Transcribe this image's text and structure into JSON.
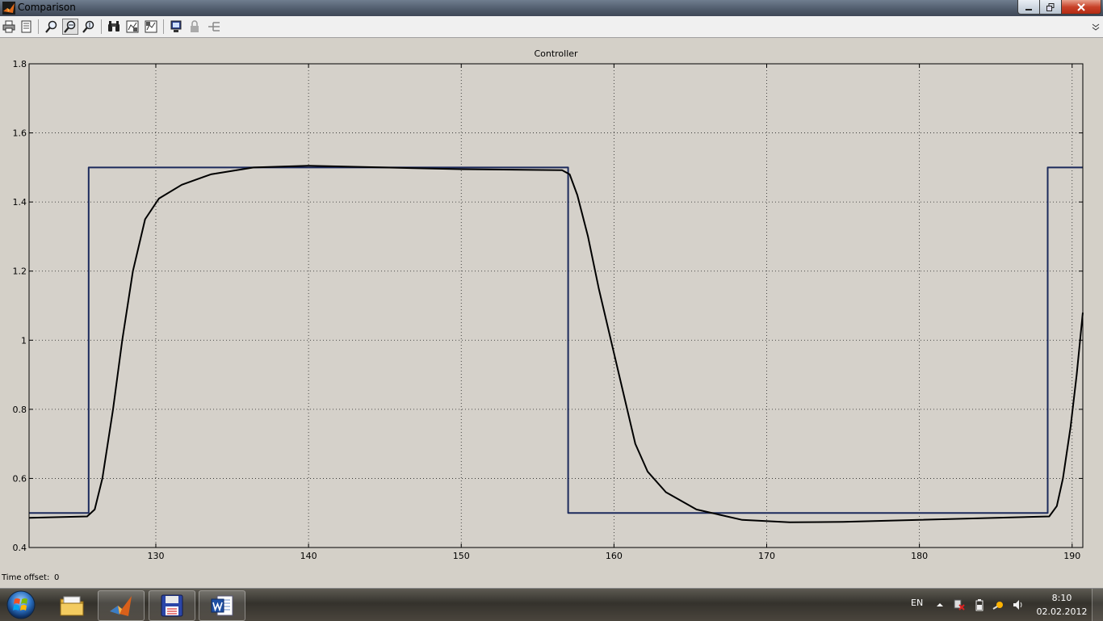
{
  "window": {
    "title": "Comparison"
  },
  "toolbar": {
    "buttons": [
      {
        "name": "print-icon"
      },
      {
        "name": "print-preview-icon"
      },
      {
        "name": "zoom-in-icon"
      },
      {
        "name": "zoom-x-icon",
        "active": true
      },
      {
        "name": "zoom-y-icon"
      },
      {
        "name": "binoculars-icon"
      },
      {
        "name": "save-axes-icon"
      },
      {
        "name": "restore-axes-icon"
      },
      {
        "name": "floating-scope-icon"
      },
      {
        "name": "lock-icon"
      },
      {
        "name": "signal-selector-icon"
      }
    ]
  },
  "chart_data": {
    "type": "line",
    "title": "Controller",
    "xlabel": "",
    "ylabel": "",
    "xlim": [
      121.7,
      190.7
    ],
    "ylim": [
      0.4,
      1.8
    ],
    "xticks": [
      130,
      140,
      150,
      160,
      170,
      180,
      190
    ],
    "yticks": [
      0.4,
      0.6,
      0.8,
      1,
      1.2,
      1.4,
      1.6,
      1.8
    ],
    "grid": true,
    "colors": {
      "reference": "#1c2a5c",
      "output": "#000000",
      "background": "#d4d0c8",
      "axes_bg": "#d5d1ca"
    },
    "series": [
      {
        "key": "reference",
        "points": [
          [
            121.7,
            0.5
          ],
          [
            125.6,
            0.5
          ],
          [
            125.6,
            1.5
          ],
          [
            157.0,
            1.5
          ],
          [
            157.0,
            0.5
          ],
          [
            188.4,
            0.5
          ],
          [
            188.4,
            1.5
          ],
          [
            190.7,
            1.5
          ]
        ]
      },
      {
        "key": "output",
        "points": [
          [
            121.7,
            0.486
          ],
          [
            125.5,
            0.49
          ],
          [
            126.0,
            0.51
          ],
          [
            126.5,
            0.6
          ],
          [
            127.2,
            0.8
          ],
          [
            127.8,
            1.0
          ],
          [
            128.5,
            1.2
          ],
          [
            129.3,
            1.35
          ],
          [
            130.2,
            1.41
          ],
          [
            131.7,
            1.45
          ],
          [
            133.6,
            1.48
          ],
          [
            136.4,
            1.5
          ],
          [
            140.0,
            1.505
          ],
          [
            145.0,
            1.5
          ],
          [
            150.0,
            1.495
          ],
          [
            156.6,
            1.492
          ],
          [
            157.1,
            1.48
          ],
          [
            157.6,
            1.42
          ],
          [
            158.3,
            1.3
          ],
          [
            159.0,
            1.15
          ],
          [
            159.8,
            1.0
          ],
          [
            160.6,
            0.85
          ],
          [
            161.4,
            0.7
          ],
          [
            162.2,
            0.62
          ],
          [
            163.4,
            0.56
          ],
          [
            165.4,
            0.51
          ],
          [
            168.4,
            0.48
          ],
          [
            171.5,
            0.473
          ],
          [
            175.0,
            0.474
          ],
          [
            180.0,
            0.48
          ],
          [
            185.0,
            0.486
          ],
          [
            188.5,
            0.49
          ],
          [
            189.0,
            0.52
          ],
          [
            189.4,
            0.6
          ],
          [
            189.9,
            0.75
          ],
          [
            190.3,
            0.9
          ],
          [
            190.7,
            1.08
          ]
        ]
      }
    ]
  },
  "status": {
    "time_offset_label": "Time offset:",
    "time_offset_value": "0"
  },
  "taskbar": {
    "items": [
      {
        "name": "explorer-icon"
      },
      {
        "name": "matlab-icon",
        "active": true
      },
      {
        "name": "save-disk-icon"
      },
      {
        "name": "word-icon"
      }
    ],
    "language": "EN",
    "time": "8:10",
    "date": "02.02.2012"
  }
}
